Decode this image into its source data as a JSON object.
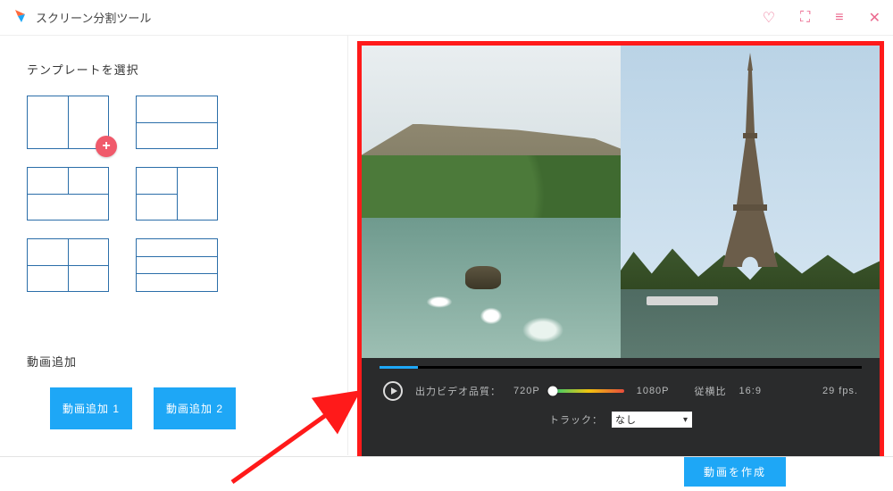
{
  "app": {
    "title": "スクリーン分割ツール"
  },
  "sidebar": {
    "template_heading": "テンプレートを選択",
    "video_add_heading": "動画追加",
    "add_buttons": [
      {
        "label": "動画追加 1"
      },
      {
        "label": "動画追加 2"
      }
    ]
  },
  "preview": {
    "progress_percent": 8,
    "quality_label": "出力ビデオ品質：",
    "quality_low": "720P",
    "quality_high": "1080P",
    "aspect_label": "従横比",
    "aspect_value": "16:9",
    "fps_label": "29 fps.",
    "track_label": "トラック：",
    "track_selected": "なし"
  },
  "footer": {
    "create_label": "動画を作成"
  }
}
